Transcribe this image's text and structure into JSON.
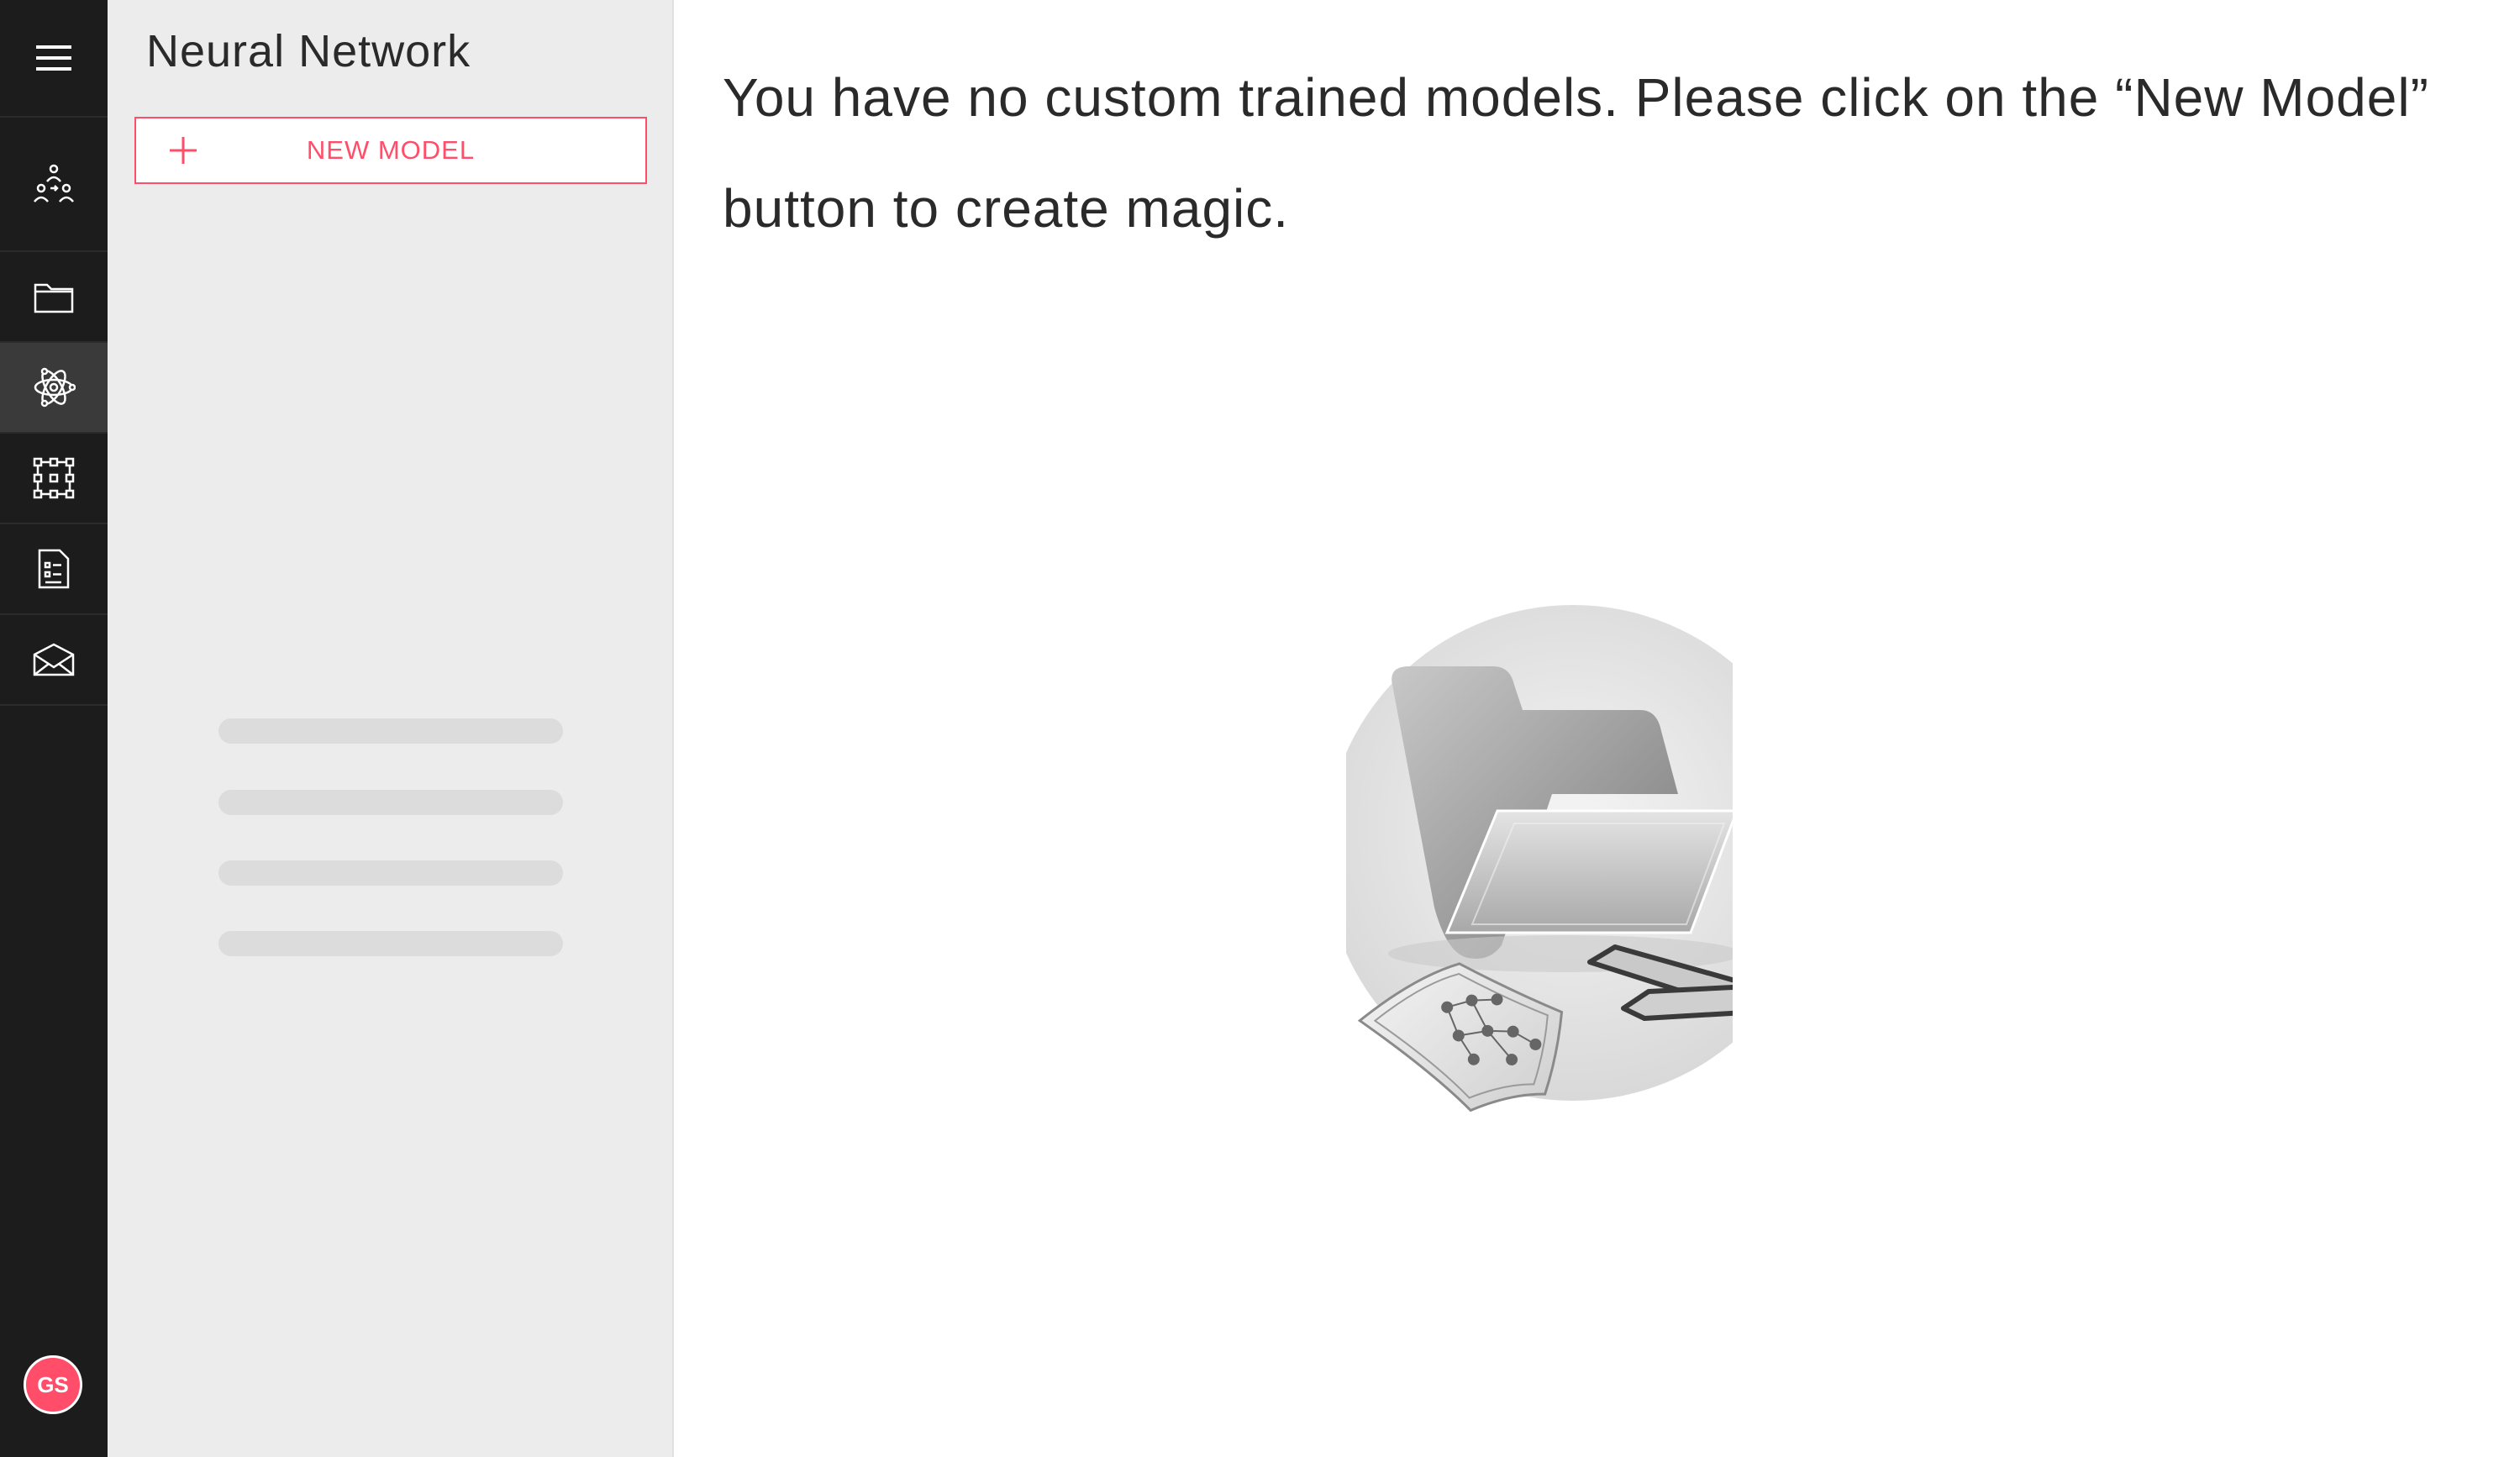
{
  "app": {
    "rail": {
      "items": [
        {
          "icon": "hamburger-menu-icon"
        },
        {
          "icon": "team-network-icon"
        },
        {
          "icon": "folder-icon"
        },
        {
          "icon": "atom-network-icon",
          "active": true
        },
        {
          "icon": "dataset-grid-icon"
        },
        {
          "icon": "report-list-icon"
        },
        {
          "icon": "mail-icon"
        }
      ],
      "avatar_initials": "GS",
      "colors": {
        "background": "#1c1c1c",
        "active": "#3a3a3a",
        "avatar": "#ff4d6a"
      }
    },
    "panel": {
      "title": "Neural Network",
      "new_model_label": "NEW MODEL",
      "new_model_icon": "plus-icon",
      "loading_placeholders": 4,
      "accent": "#ff4d6a"
    },
    "main": {
      "empty_message": "You have no custom trained models. Please click on the “New Model” button to create magic.",
      "illustration": "empty-folder-illustration"
    }
  }
}
